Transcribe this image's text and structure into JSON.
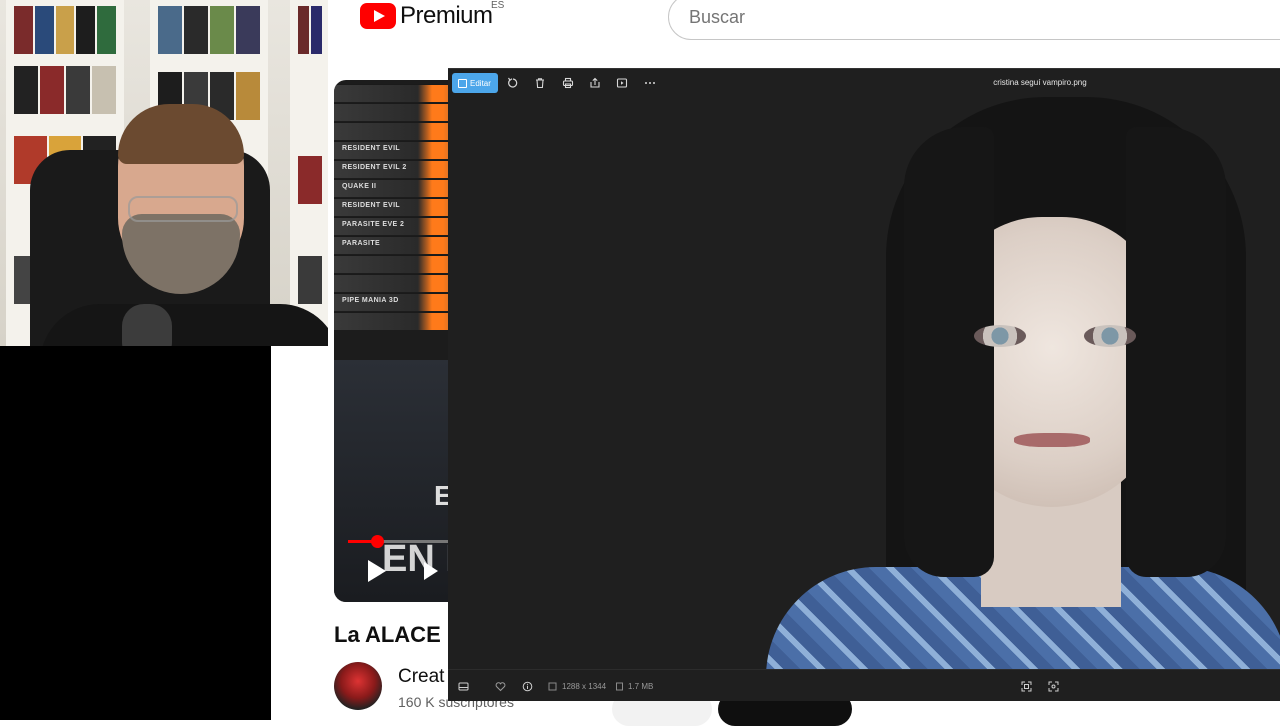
{
  "youtube": {
    "logo_word": "Premium",
    "country_code": "ES",
    "search_placeholder": "Buscar",
    "thumbnail": {
      "shelf_titles": [
        "",
        "",
        "",
        "RESIDENT EVIL",
        "RESIDENT EVIL 2",
        "QUAKE II",
        "RESIDENT EVIL",
        "PARASITE EVE 2",
        "PARASITE",
        "",
        "",
        "PIPE MANIA 3D",
        ""
      ],
      "overlay_text": "EN F",
      "overlay_letter": "E",
      "progress": 0.23
    },
    "video_title": "La ALACE",
    "channel_name": "Creat",
    "channel_subscribers": "160 K suscriptores"
  },
  "viewer": {
    "edit_label": "Editar",
    "file_name": "cristina seguí vampiro.png",
    "dimensions": "1288 x 1344",
    "file_size": "1.7 MB",
    "toolbar_icons": [
      "rotate-icon",
      "delete-icon",
      "print-icon",
      "share-icon",
      "slideshow-icon",
      "more-icon"
    ],
    "status_icons": [
      "filmstrip-icon",
      "favorite-icon",
      "info-icon",
      "fit-icon",
      "fullscreen-icon"
    ]
  },
  "colors": {
    "youtube_red": "#ff0000",
    "viewer_bg": "#1f1f1f",
    "edit_accent": "#4ca6ea"
  }
}
